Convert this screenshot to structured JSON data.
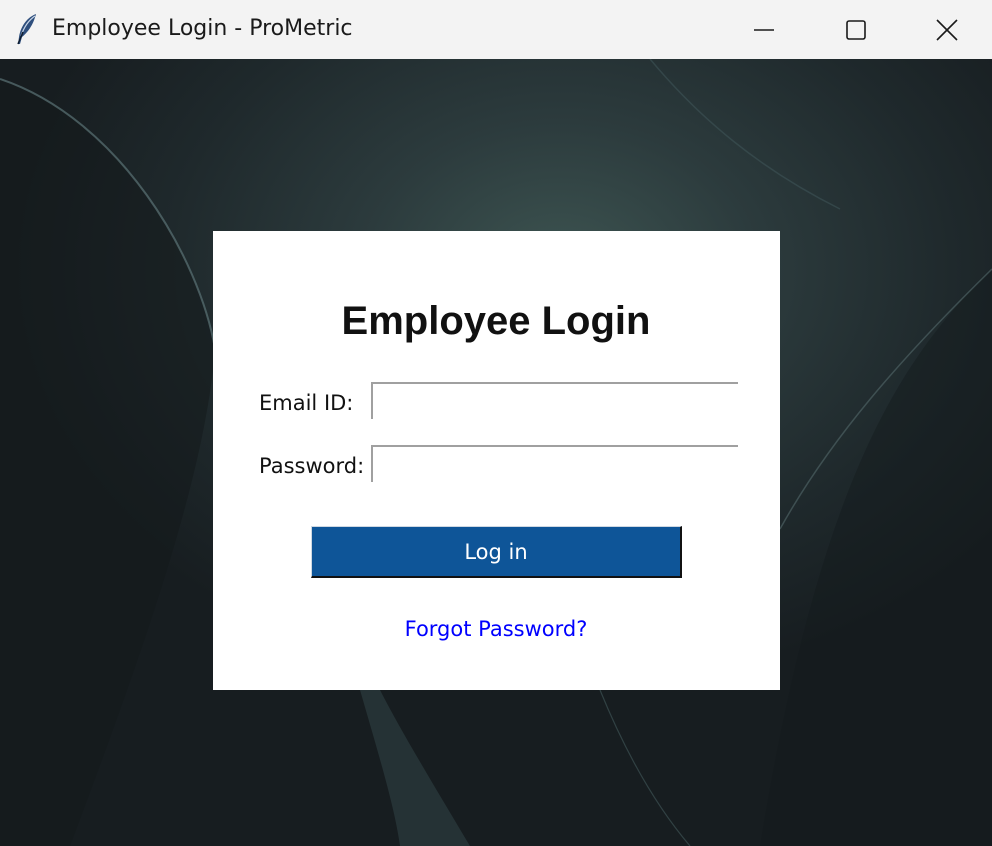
{
  "window": {
    "title": "Employee Login - ProMetric",
    "app_icon": "feather-icon",
    "controls": {
      "minimize_icon": "minimize-icon",
      "maximize_icon": "maximize-icon",
      "close_icon": "close-icon"
    }
  },
  "login": {
    "heading": "Employee Login",
    "email_label": "Email ID:",
    "email_value": "",
    "password_label": "Password:",
    "password_value": "",
    "login_button_label": "Log in",
    "forgot_link_label": "Forgot Password?"
  },
  "colors": {
    "button_background": "#0e5598",
    "button_text": "#ffffff",
    "link": "#0000ff",
    "panel_background": "#ffffff",
    "titlebar_background": "#f3f3f3"
  }
}
